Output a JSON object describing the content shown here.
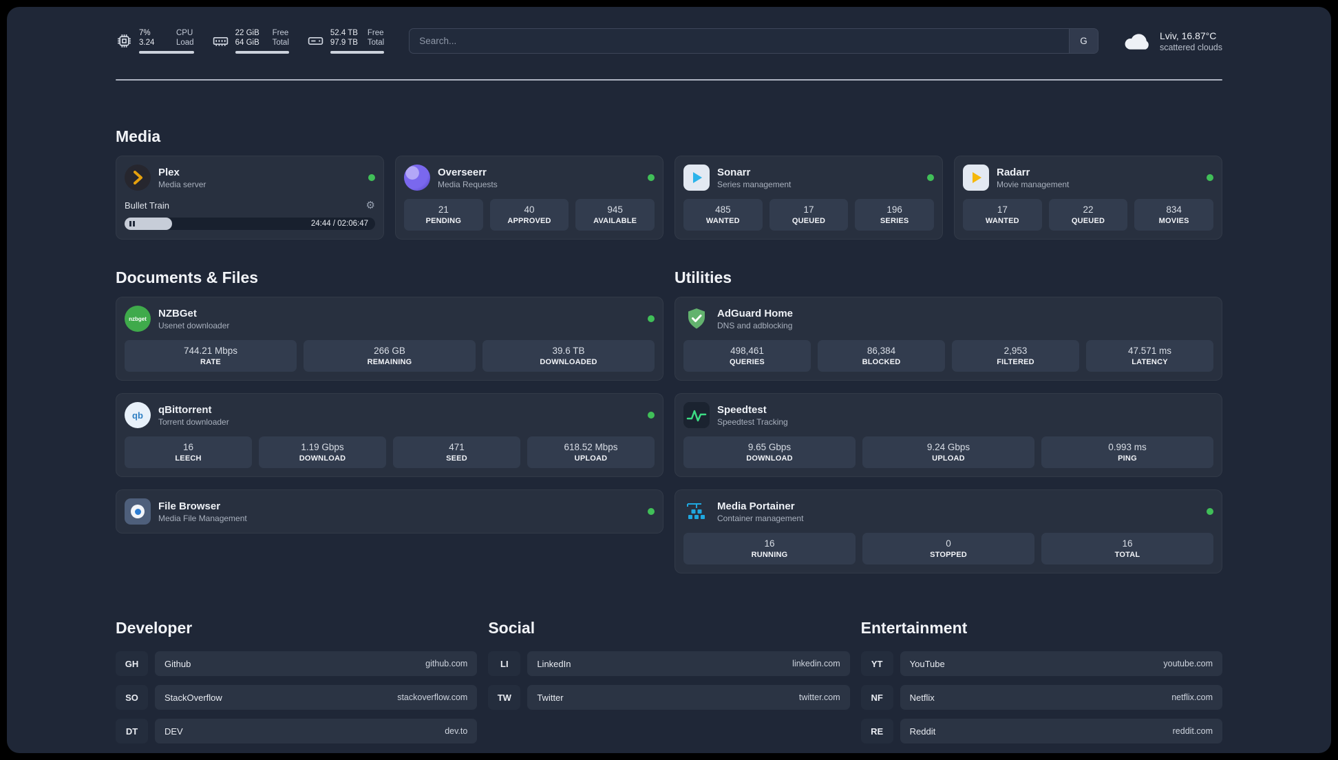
{
  "header": {
    "cpu": {
      "value": "7%",
      "sub": "3.24",
      "label_top": "CPU",
      "label_bottom": "Load"
    },
    "ram": {
      "value": "22 GiB",
      "sub": "64 GiB",
      "label_top": "Free",
      "label_bottom": "Total"
    },
    "disk": {
      "value": "52.4 TB",
      "sub": "97.9 TB",
      "label_top": "Free",
      "label_bottom": "Total"
    },
    "search": {
      "placeholder": "Search...",
      "engine": "G"
    },
    "weather": {
      "location": "Lviv, 16.87°C",
      "condition": "scattered clouds"
    }
  },
  "sections": {
    "media": "Media",
    "documents": "Documents & Files",
    "utilities": "Utilities",
    "developer": "Developer",
    "social": "Social",
    "entertainment": "Entertainment"
  },
  "apps": {
    "plex": {
      "name": "Plex",
      "subtitle": "Media server",
      "now_playing": "Bullet Train",
      "time": "24:44 / 02:06:47"
    },
    "overseerr": {
      "name": "Overseerr",
      "subtitle": "Media Requests",
      "stats": [
        {
          "value": "21",
          "label": "PENDING"
        },
        {
          "value": "40",
          "label": "APPROVED"
        },
        {
          "value": "945",
          "label": "AVAILABLE"
        }
      ]
    },
    "sonarr": {
      "name": "Sonarr",
      "subtitle": "Series management",
      "stats": [
        {
          "value": "485",
          "label": "WANTED"
        },
        {
          "value": "17",
          "label": "QUEUED"
        },
        {
          "value": "196",
          "label": "SERIES"
        }
      ]
    },
    "radarr": {
      "name": "Radarr",
      "subtitle": "Movie management",
      "stats": [
        {
          "value": "17",
          "label": "WANTED"
        },
        {
          "value": "22",
          "label": "QUEUED"
        },
        {
          "value": "834",
          "label": "MOVIES"
        }
      ]
    },
    "nzbget": {
      "name": "NZBGet",
      "subtitle": "Usenet downloader",
      "icon_text": "nzbget",
      "stats": [
        {
          "value": "744.21 Mbps",
          "label": "RATE"
        },
        {
          "value": "266 GB",
          "label": "REMAINING"
        },
        {
          "value": "39.6 TB",
          "label": "DOWNLOADED"
        }
      ]
    },
    "qbittorrent": {
      "name": "qBittorrent",
      "subtitle": "Torrent downloader",
      "icon_text": "qb",
      "stats": [
        {
          "value": "16",
          "label": "LEECH"
        },
        {
          "value": "1.19 Gbps",
          "label": "DOWNLOAD"
        },
        {
          "value": "471",
          "label": "SEED"
        },
        {
          "value": "618.52 Mbps",
          "label": "UPLOAD"
        }
      ]
    },
    "filebrowser": {
      "name": "File Browser",
      "subtitle": "Media File Management"
    },
    "adguard": {
      "name": "AdGuard Home",
      "subtitle": "DNS and adblocking",
      "stats": [
        {
          "value": "498,461",
          "label": "QUERIES"
        },
        {
          "value": "86,384",
          "label": "BLOCKED"
        },
        {
          "value": "2,953",
          "label": "FILTERED"
        },
        {
          "value": "47.571 ms",
          "label": "LATENCY"
        }
      ]
    },
    "speedtest": {
      "name": "Speedtest",
      "subtitle": "Speedtest Tracking",
      "stats": [
        {
          "value": "9.65 Gbps",
          "label": "DOWNLOAD"
        },
        {
          "value": "9.24 Gbps",
          "label": "UPLOAD"
        },
        {
          "value": "0.993 ms",
          "label": "PING"
        }
      ]
    },
    "portainer": {
      "name": "Media Portainer",
      "subtitle": "Container management",
      "stats": [
        {
          "value": "16",
          "label": "RUNNING"
        },
        {
          "value": "0",
          "label": "STOPPED"
        },
        {
          "value": "16",
          "label": "TOTAL"
        }
      ]
    }
  },
  "bookmarks": {
    "developer": [
      {
        "abbr": "GH",
        "name": "Github",
        "url": "github.com"
      },
      {
        "abbr": "SO",
        "name": "StackOverflow",
        "url": "stackoverflow.com"
      },
      {
        "abbr": "DT",
        "name": "DEV",
        "url": "dev.to"
      }
    ],
    "social": [
      {
        "abbr": "LI",
        "name": "LinkedIn",
        "url": "linkedin.com"
      },
      {
        "abbr": "TW",
        "name": "Twitter",
        "url": "twitter.com"
      }
    ],
    "entertainment": [
      {
        "abbr": "YT",
        "name": "YouTube",
        "url": "youtube.com"
      },
      {
        "abbr": "NF",
        "name": "Netflix",
        "url": "netflix.com"
      },
      {
        "abbr": "RE",
        "name": "Reddit",
        "url": "reddit.com"
      }
    ]
  },
  "colors": {
    "status_online": "#40bf58",
    "plex_accent": "#e5a00d",
    "sonarr_accent": "#2bb3ea",
    "radarr_accent": "#f5b80c",
    "nzbget_accent": "#3faa4b",
    "adguard_accent": "#63b26e",
    "speedtest_accent": "#3ddc84",
    "portainer_accent": "#1fa8e0"
  }
}
